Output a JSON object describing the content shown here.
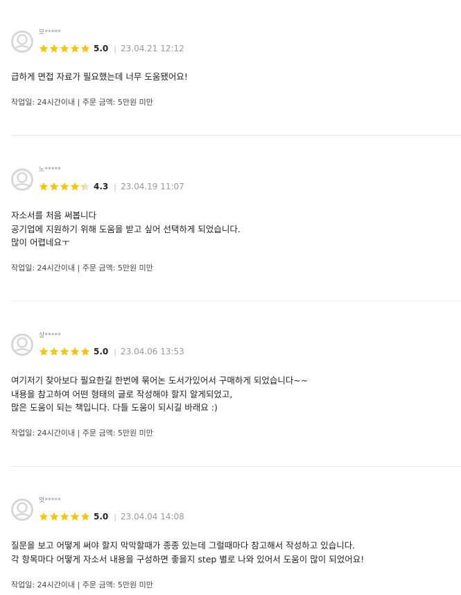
{
  "reviews": [
    {
      "author": "모*****",
      "rating": 5.0,
      "score": "5.0",
      "date": "23.04.21 12:12",
      "lines": [
        "급하게 면접 자료가 필요했는데 너무 도움됐어요!"
      ],
      "meta": "작업일: 24시간이내 | 주문 금액: 5만원 미만"
    },
    {
      "author": "노*****",
      "rating": 4.3,
      "score": "4.3",
      "date": "23.04.19 11:07",
      "lines": [
        "자소서를 처음 써봅니다",
        "공기업에 지원하기 위해 도움을 받고 싶어 선택하게 되었습니다.",
        "많이 어렵네요ㅜ"
      ],
      "meta": "작업일: 24시간이내 | 주문 금액: 5만원 미만"
    },
    {
      "author": "샹*****",
      "rating": 5.0,
      "score": "5.0",
      "date": "23.04.06 13:53",
      "lines": [
        "여기저기 찾아보다 필요한길 한번에 묶어논 도서가있어서 구매하게 되었습니다~~",
        "내용을 참고하여 어떤 형태의 글로 작성해야 할지 알게되었고,",
        "많은 도움이 되는 책입니다.  다들 도움이 되시길 바래요 :)"
      ],
      "meta": "작업일: 24시간이내 | 주문 금액: 5만원 미만"
    },
    {
      "author": "멋*****",
      "rating": 5.0,
      "score": "5.0",
      "date": "23.04.04 14:08",
      "lines": [
        "질문을 보고 어떻게 써야 할지 막막할때가 종종 있는데 그럴때마다 참고해서 작성하고 있습니다.",
        "각 항목마다 어떻게 자소서 내용을 구성하면 좋을지 step 별로 나와 있어서 도움이 많이 되었어요!"
      ],
      "meta": "작업일: 24시간이내 | 주문 금액: 5만원 미만"
    }
  ],
  "colors": {
    "star": "#f7c600",
    "star_empty": "#e2e2e2",
    "avatar": "#d7d7d7"
  },
  "icons": {
    "avatar": "user-avatar-icon",
    "star": "star-icon"
  }
}
